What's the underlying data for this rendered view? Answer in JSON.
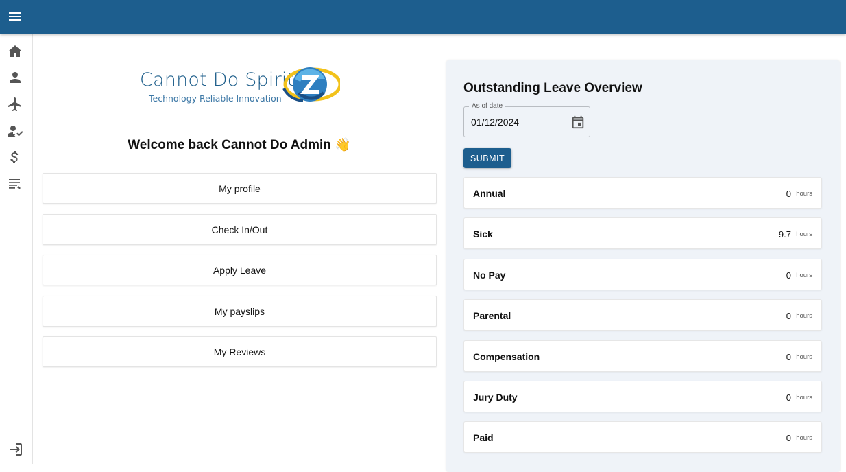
{
  "header": {
    "menu_icon": "menu-icon",
    "color": "#1d5e8e"
  },
  "sidebar": {
    "items": [
      {
        "name": "home",
        "icon": "home-icon"
      },
      {
        "name": "profile",
        "icon": "person-icon"
      },
      {
        "name": "leave",
        "icon": "airplane-icon"
      },
      {
        "name": "check-in",
        "icon": "person-check-icon"
      },
      {
        "name": "payslips",
        "icon": "dollar-icon"
      },
      {
        "name": "reviews",
        "icon": "list-icon"
      }
    ],
    "logout_icon": "logout-icon"
  },
  "logo": {
    "name": "Cannot Do Spirit",
    "tagline": "Technology Reliable Innovation"
  },
  "welcome": "Welcome back Cannot Do Admin 👋",
  "actions": [
    {
      "label": "My profile"
    },
    {
      "label": "Check In/Out"
    },
    {
      "label": "Apply Leave"
    },
    {
      "label": "My payslips"
    },
    {
      "label": "My Reviews"
    }
  ],
  "leave_overview": {
    "title": "Outstanding Leave Overview",
    "date_field": {
      "label": "As of date",
      "value": "01/12/2024"
    },
    "submit_label": "SUBMIT",
    "unit": "hours",
    "items": [
      {
        "name": "Annual",
        "value": "0"
      },
      {
        "name": "Sick",
        "value": "9.7"
      },
      {
        "name": "No Pay",
        "value": "0"
      },
      {
        "name": "Parental",
        "value": "0"
      },
      {
        "name": "Compensation",
        "value": "0"
      },
      {
        "name": "Jury Duty",
        "value": "0"
      },
      {
        "name": "Paid",
        "value": "0"
      }
    ]
  }
}
